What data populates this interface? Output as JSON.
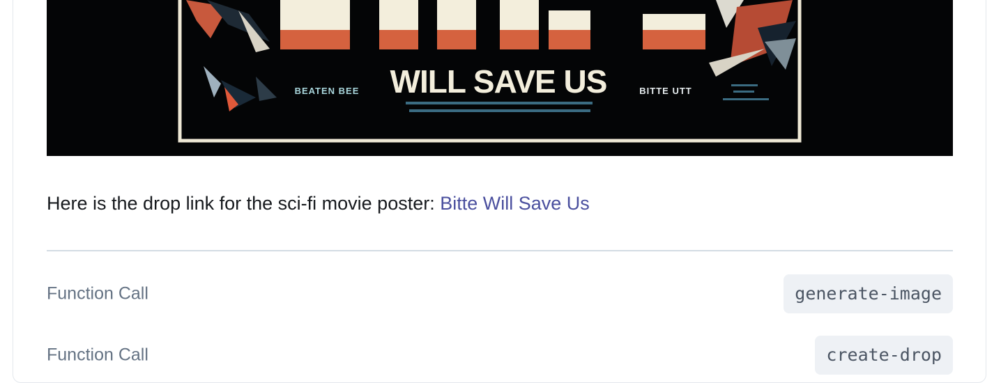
{
  "poster": {
    "title_partial": "BITTE",
    "subtitle": "WILL SAVE US",
    "left_caption": "BEATEN BEE",
    "right_caption": "BITTE UTT"
  },
  "message": {
    "prefix": "Here is the drop link for the sci-fi movie poster: ",
    "link_text": "Bitte Will Save Us"
  },
  "function_calls": [
    {
      "label": "Function Call",
      "name": "generate-image"
    },
    {
      "label": "Function Call",
      "name": "create-drop"
    }
  ],
  "colors": {
    "link": "#4a4f9e",
    "label": "#647283",
    "chip_bg": "#eef1f5",
    "divider": "#d3dbe3"
  }
}
